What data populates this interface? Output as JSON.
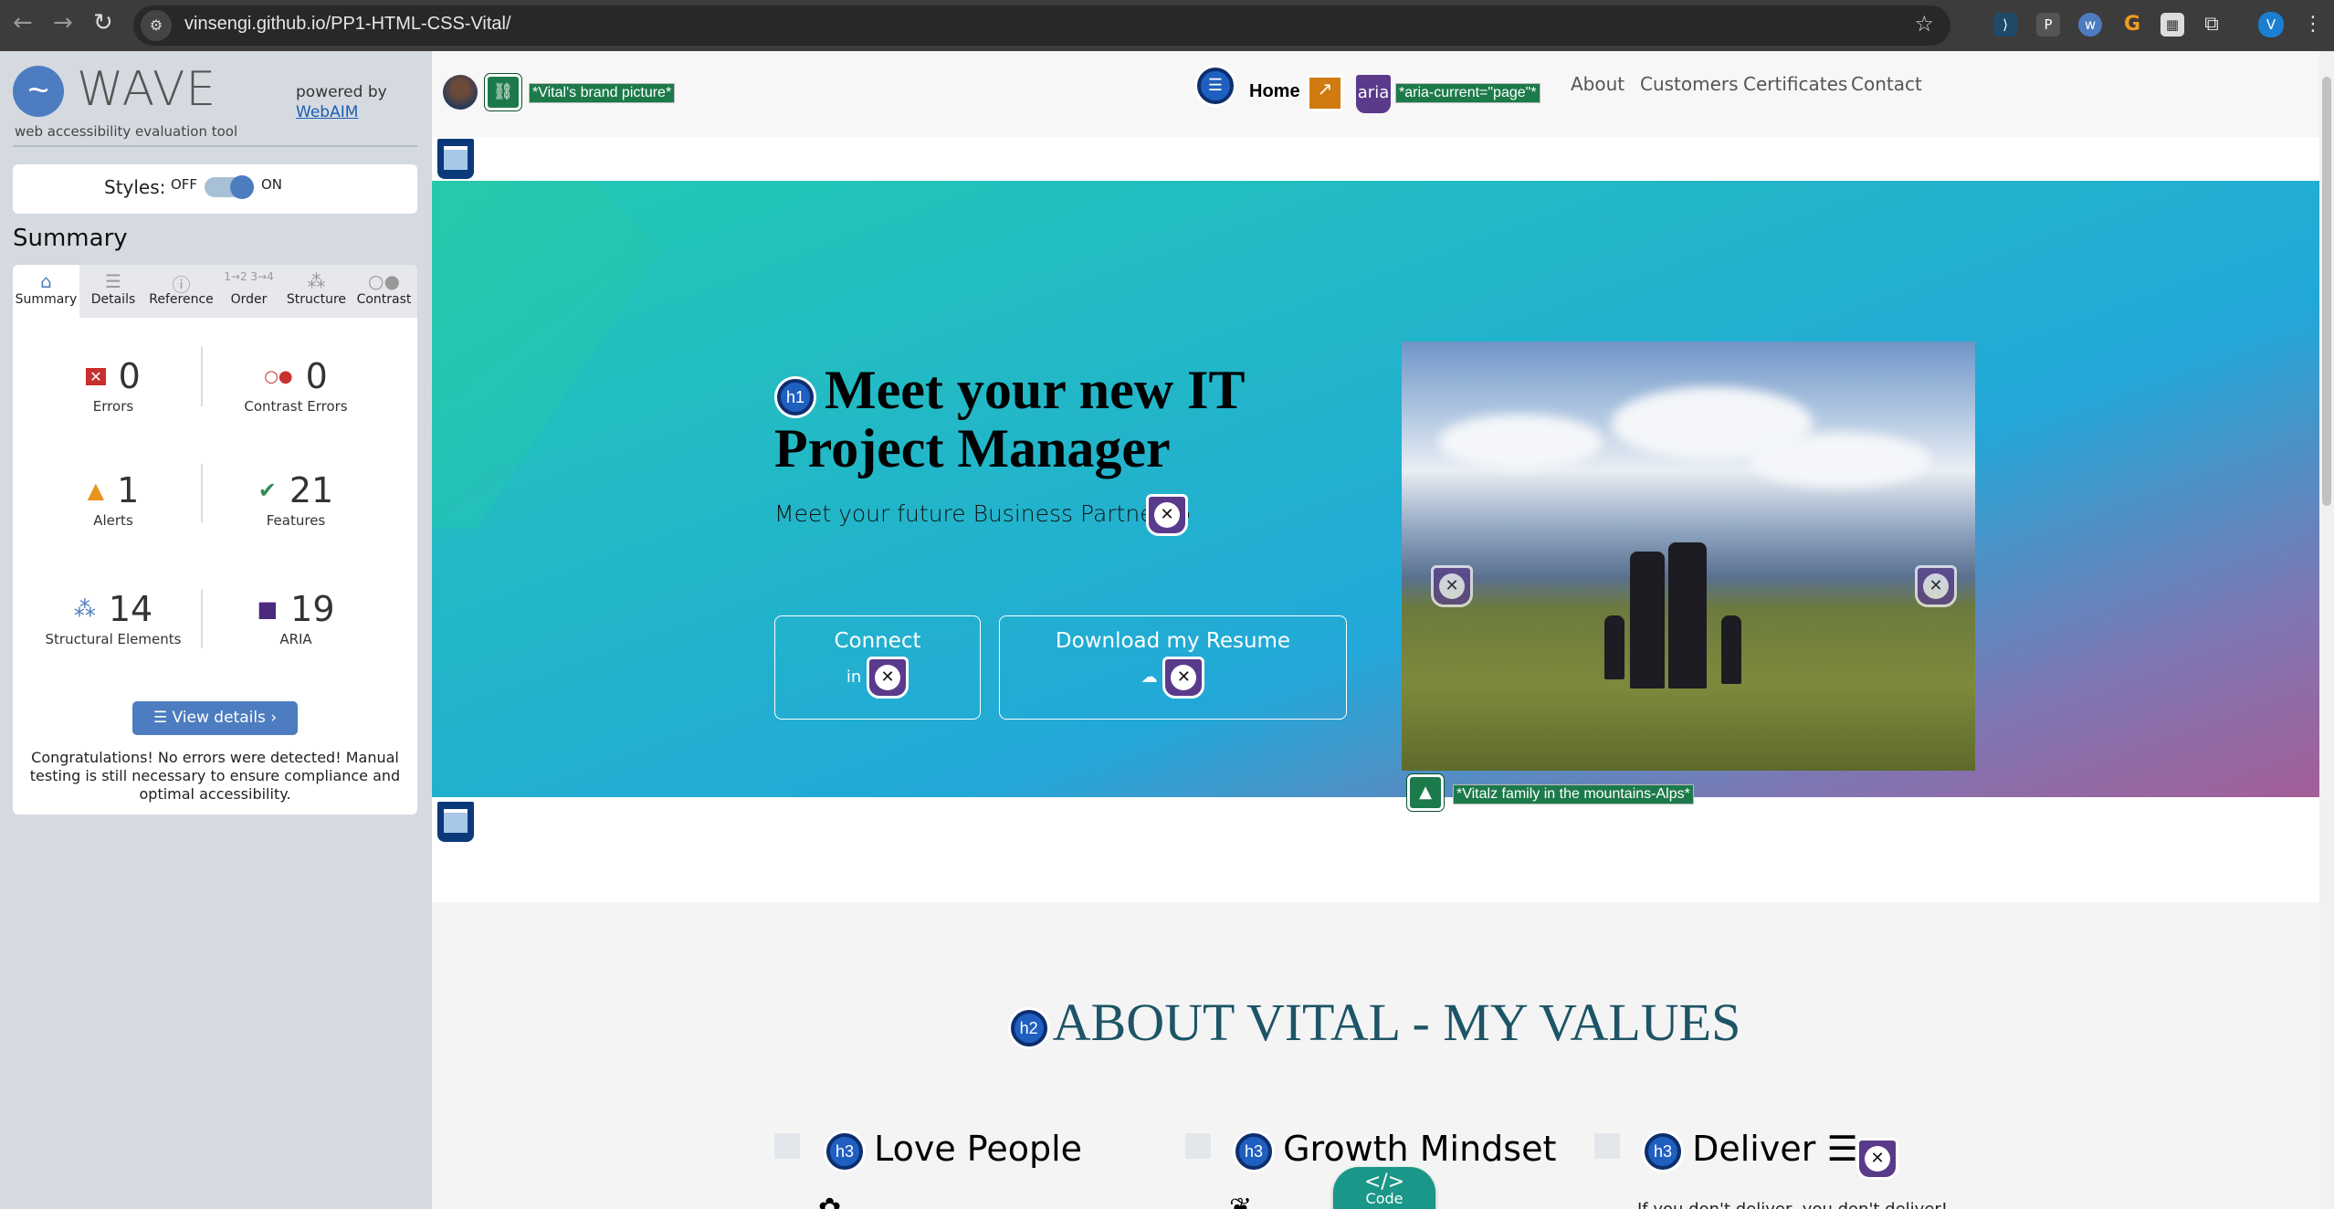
{
  "browser": {
    "url": "vinsengi.github.io/PP1-HTML-CSS-Vital/",
    "profile_initial": "V"
  },
  "wave": {
    "logo_text": "WAVE",
    "subtitle": "web accessibility evaluation tool",
    "powered_by": "powered by",
    "webaim_link": "WebAIM",
    "styles_label": "Styles:",
    "styles_off": "OFF",
    "styles_on": "ON",
    "styles_enabled": true,
    "summary_heading": "Summary",
    "tabs": [
      {
        "label": "Summary",
        "icon": "home-icon"
      },
      {
        "label": "Details",
        "icon": "list-icon"
      },
      {
        "label": "Reference",
        "icon": "info-icon"
      },
      {
        "label": "Order",
        "icon": "order-icon"
      },
      {
        "label": "Structure",
        "icon": "structure-icon"
      },
      {
        "label": "Contrast",
        "icon": "contrast-icon"
      }
    ],
    "stats": {
      "errors": {
        "count": "0",
        "label": "Errors",
        "color": "#c7302f"
      },
      "contrast_errors": {
        "count": "0",
        "label": "Contrast Errors",
        "color": "#c7302f"
      },
      "alerts": {
        "count": "1",
        "label": "Alerts",
        "color": "#e8931b"
      },
      "features": {
        "count": "21",
        "label": "Features",
        "color": "#2f8a57"
      },
      "structural": {
        "count": "14",
        "label": "Structural Elements",
        "color": "#4d7cc0"
      },
      "aria": {
        "count": "19",
        "label": "ARIA",
        "color": "#4b2a80"
      }
    },
    "view_details": "View details ›",
    "congrats": "Congratulations! No errors were detected! Manual testing is still necessary to ensure compliance and optimal accessibility."
  },
  "site": {
    "brand_alt": "*Vital's brand picture*",
    "nav": {
      "home": "Home",
      "aria_badge": "aria",
      "aria_current": "*aria-current=\"page\"*",
      "links": [
        "About",
        "Customers",
        "Certificates",
        "Contact"
      ]
    },
    "hero": {
      "h1_badge": "h1",
      "title": "Meet your new IT Project Manager",
      "subtitle": "Meet your future Business Partner",
      "connect": "Connect",
      "download": "Download my Resume",
      "photo_alt": "*Vitalz family in the mountains-Alps*"
    },
    "about": {
      "h2_badge": "h2",
      "heading": "ABOUT VITAL - MY VALUES",
      "h3_badge": "h3",
      "values": [
        "Love People",
        "Growth Mindset",
        "Deliver"
      ],
      "deliver_text": "If you don't deliver, you don't deliver!"
    },
    "code_badge": "Code"
  }
}
